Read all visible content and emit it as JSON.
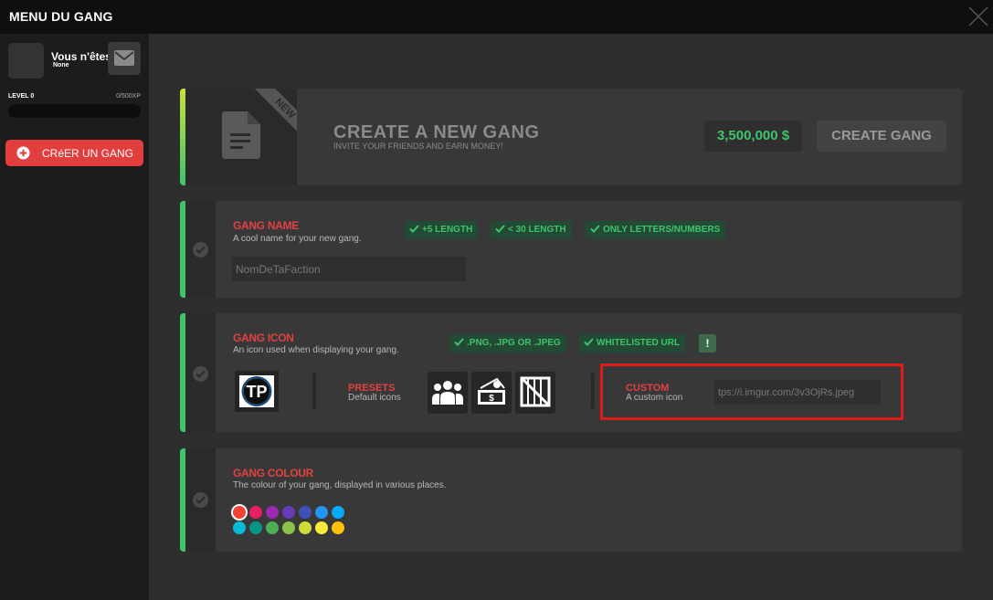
{
  "window": {
    "title": "MENU DU GANG"
  },
  "sidebar": {
    "user_name": "Vous n'êtes",
    "user_sub": "None",
    "level_label": "LEVEL 0",
    "xp_label": "0/500XP",
    "xp_progress": 0,
    "create_button": "CRéER UN GANG"
  },
  "create_panel": {
    "ribbon": "NEW",
    "title": "CREATE A NEW GANG",
    "subtitle": "INVITE YOUR FRIENDS AND EARN MONEY!",
    "price": "3,500,000 $",
    "button": "CREATE GANG"
  },
  "name_section": {
    "title": "GANG NAME",
    "description": "A cool name for your new gang.",
    "requirements": [
      "+5 LENGTH",
      "< 30 LENGTH",
      "ONLY LETTERS/NUMBERS"
    ],
    "input_value": "NomDeTaFaction"
  },
  "icon_section": {
    "title": "GANG ICON",
    "description": "An icon used when displaying your gang.",
    "requirements": [
      ".PNG, .JPG OR .JPEG",
      "WHITELISTED URL"
    ],
    "warning": "!",
    "presets_title": "PRESETS",
    "presets_desc": "Default icons",
    "preset_icons": [
      "group-icon",
      "money-stack-icon",
      "crate-icon"
    ],
    "custom_title": "CUSTOM",
    "custom_desc": "A custom icon",
    "custom_url": "tps://i.imgur.com/3v3OjRs.jpeg",
    "current_icon_text": "TP"
  },
  "colour_section": {
    "title": "GANG COLOUR",
    "description": "The colour of your gang, displayed in various places.",
    "colors_row1": [
      "#f44336",
      "#e91e63",
      "#9c27b0",
      "#673ab7",
      "#3f51b5",
      "#2196f3",
      "#03a9f4"
    ],
    "colors_row2": [
      "#00bcd4",
      "#009688",
      "#4caf50",
      "#8bc34a",
      "#cddc39",
      "#ffeb3b",
      "#ffc107"
    ],
    "selected_color": "#f44336"
  },
  "colors": {
    "accent_green": "#3ec46d",
    "accent_red": "#e34141",
    "highlight": "#e01b1b"
  }
}
